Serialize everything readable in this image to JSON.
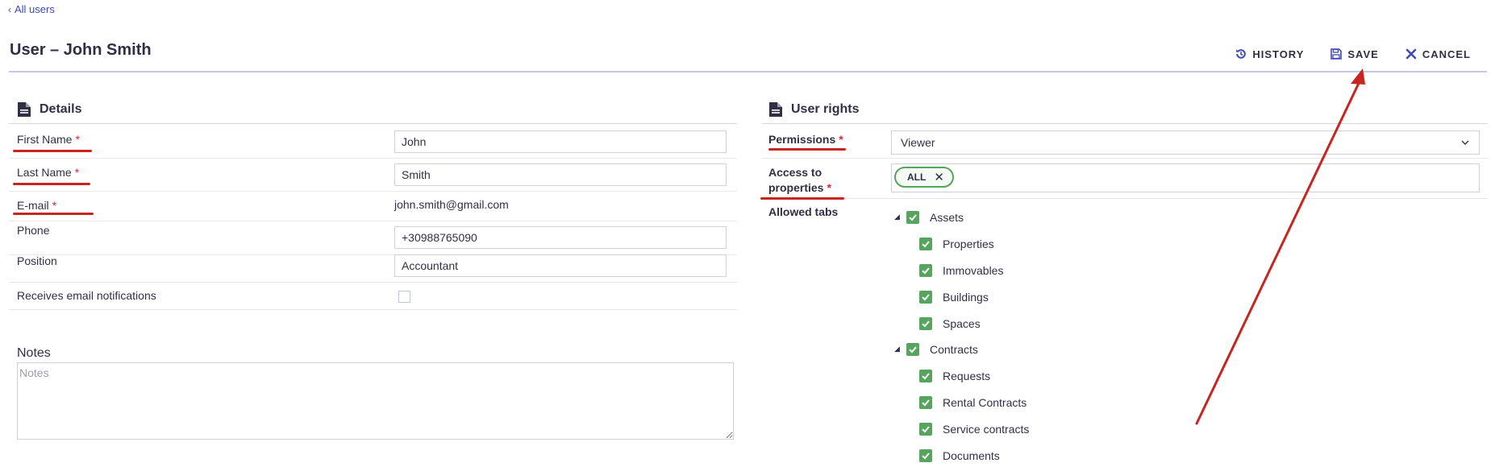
{
  "nav": {
    "back_label": "All users"
  },
  "header": {
    "title": "User – John Smith"
  },
  "toolbar": {
    "history_label": "HISTORY",
    "save_label": "SAVE",
    "cancel_label": "CANCEL"
  },
  "details": {
    "title": "Details",
    "fields": {
      "first_name": {
        "label": "First Name",
        "required": "*",
        "value": "John"
      },
      "last_name": {
        "label": "Last Name",
        "required": "*",
        "value": "Smith"
      },
      "email": {
        "label": "E-mail",
        "required": "*",
        "value": "john.smith@gmail.com"
      },
      "phone": {
        "label": "Phone",
        "value": "+30988765090"
      },
      "position": {
        "label": "Position",
        "value": "Accountant"
      },
      "notifications": {
        "label": "Receives email notifications",
        "checked": false
      }
    },
    "notes": {
      "label": "Notes",
      "placeholder": "Notes",
      "value": ""
    }
  },
  "user_rights": {
    "title": "User rights",
    "permissions": {
      "label": "Permissions",
      "required": "*",
      "value": "Viewer"
    },
    "access": {
      "label_line1": "Access to",
      "label_line2": "properties",
      "required": "*",
      "tag": "ALL"
    },
    "allowed_tabs": {
      "label": "Allowed tabs",
      "groups": [
        {
          "label": "Assets",
          "checked": true,
          "children": [
            "Properties",
            "Immovables",
            "Buildings",
            "Spaces"
          ]
        },
        {
          "label": "Contracts",
          "checked": true,
          "children": [
            "Requests",
            "Rental Contracts",
            "Service contracts",
            "Documents"
          ]
        }
      ]
    }
  },
  "annotations": {
    "underline_color": "#c7251f",
    "arrow_color": "#c7251f"
  },
  "colors": {
    "accent": "#3f4ab1",
    "checkbox_green": "#56a45e",
    "title_text": "#2f3045",
    "required": "#d7263d"
  }
}
